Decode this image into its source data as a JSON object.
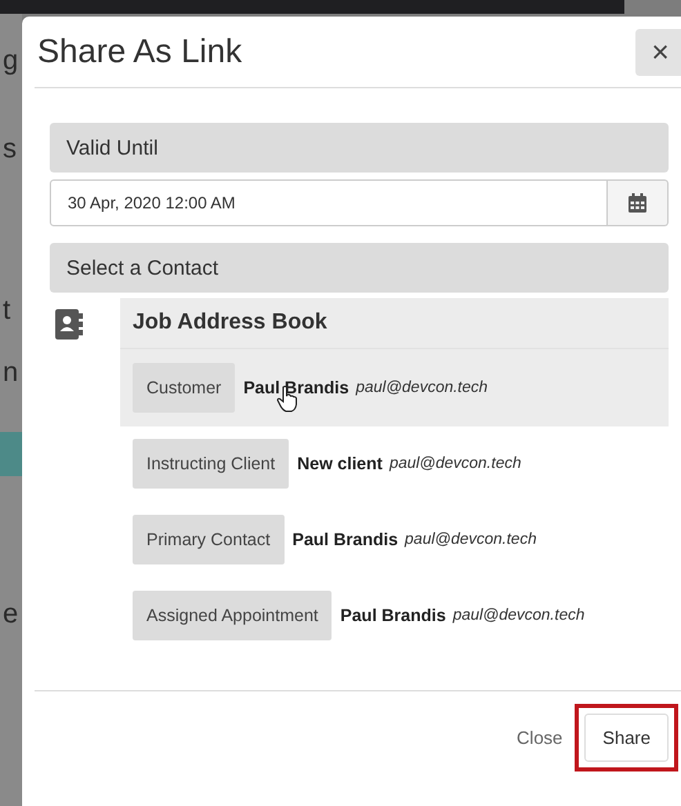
{
  "background": {
    "fragments": [
      "g",
      "s",
      "t",
      "n",
      "e"
    ]
  },
  "dialog": {
    "title": "Share As Link",
    "close_icon": "×",
    "valid_until": {
      "label": "Valid Until",
      "value": "30 Apr, 2020 12:00 AM"
    },
    "contact": {
      "label": "Select a Contact",
      "book": "Job Address Book",
      "rows": [
        {
          "role": "Customer",
          "name": "Paul Brandis",
          "email": "paul@devcon.tech",
          "highlighted": true
        },
        {
          "role": "Instructing Client",
          "name": "New client",
          "email": "paul@devcon.tech",
          "highlighted": false
        },
        {
          "role": "Primary Contact",
          "name": "Paul Brandis",
          "email": "paul@devcon.tech",
          "highlighted": false
        },
        {
          "role": "Assigned Appointment",
          "name": "Paul Brandis",
          "email": "paul@devcon.tech",
          "highlighted": false
        }
      ]
    },
    "buttons": {
      "close": "Close",
      "share": "Share",
      "share_outlined": true
    }
  }
}
